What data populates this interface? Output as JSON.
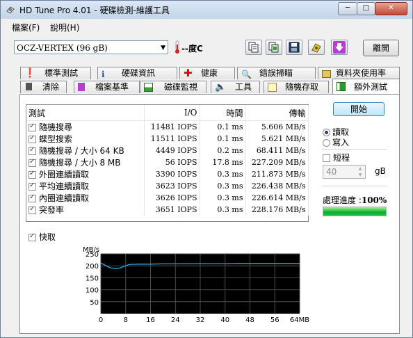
{
  "window": {
    "title": "HD Tune Pro 4.01 - 硬碟檢測-維護工具"
  },
  "menu": [
    {
      "label": "檔案(F)"
    },
    {
      "label": "說明(H)"
    }
  ],
  "toolbar": {
    "drive": "OCZ-VERTEX (96 gB)",
    "temperature": "--度C",
    "exit_label": "離開",
    "buttons": [
      "copy-text-icon",
      "copy-screenshot-icon",
      "save-icon",
      "options-icon",
      "download-icon"
    ]
  },
  "tabs_top": [
    {
      "label": "標準測試",
      "icon": "benchmark-icon"
    },
    {
      "label": "硬碟資訊",
      "icon": "info-icon"
    },
    {
      "label": "健康",
      "icon": "health-icon"
    },
    {
      "label": "錯誤掃瞄",
      "icon": "error-scan-icon"
    },
    {
      "label": "資料夾使用率",
      "icon": "folder-usage-icon"
    }
  ],
  "tabs_bottom": [
    {
      "label": "清除",
      "icon": "erase-icon"
    },
    {
      "label": "檔案基準",
      "icon": "file-benchmark-icon"
    },
    {
      "label": "磁碟監視",
      "icon": "disk-monitor-icon"
    },
    {
      "label": "工具",
      "icon": "tools-icon"
    },
    {
      "label": "隨機存取",
      "icon": "random-access-icon"
    },
    {
      "label": "額外測試",
      "icon": "extra-tests-icon",
      "active": true
    }
  ],
  "results": {
    "columns": [
      "測試",
      "I/O",
      "時間",
      "傳輸"
    ],
    "rows": [
      {
        "name": "隨機搜尋",
        "io": "11481 IOPS",
        "time": "0.1 ms",
        "transfer": "5.606 MB/s"
      },
      {
        "name": "蝶型搜索",
        "io": "11511 IOPS",
        "time": "0.1 ms",
        "transfer": "5.621 MB/s"
      },
      {
        "name": "隨機搜尋 / 大小 64 KB",
        "io": "4449 IOPS",
        "time": "0.2 ms",
        "transfer": "68.411 MB/s"
      },
      {
        "name": "隨機搜尋 / 大小 8 MB",
        "io": "56 IOPS",
        "time": "17.8 ms",
        "transfer": "227.209 MB/s"
      },
      {
        "name": "外圈連續讀取",
        "io": "3390 IOPS",
        "time": "0.3 ms",
        "transfer": "211.873 MB/s"
      },
      {
        "name": "平均連續讀取",
        "io": "3623 IOPS",
        "time": "0.3 ms",
        "transfer": "226.438 MB/s"
      },
      {
        "name": "內圈連續讀取",
        "io": "3626 IOPS",
        "time": "0.3 ms",
        "transfer": "226.614 MB/s"
      },
      {
        "name": "突發率",
        "io": "3651 IOPS",
        "time": "0.3 ms",
        "transfer": "228.176 MB/s"
      }
    ]
  },
  "controls": {
    "start_label": "開始",
    "read_label": "讀取",
    "write_label": "寫入",
    "short_label": "短程",
    "size_value": "40",
    "size_unit": "gB",
    "progress_label": "處理進度 :",
    "progress_value": "100%",
    "progress_fraction": 1.0,
    "cache_label": "快取"
  },
  "colors": {
    "graph_bg": "#000000",
    "graph_grid": "#4a4a4a",
    "graph_line": "#3aa0d8",
    "progress": "#06b025"
  },
  "chart_data": {
    "type": "line",
    "ylabel": "MB/s",
    "xlabel": "",
    "x_unit": "MB",
    "x_ticks": [
      "0",
      "8",
      "16",
      "24",
      "32",
      "40",
      "48",
      "56",
      "64MB"
    ],
    "y_ticks": [
      "250",
      "200",
      "150",
      "100",
      "50"
    ],
    "xlim": [
      0,
      64
    ],
    "ylim": [
      0,
      250
    ],
    "grid": true,
    "series": [
      {
        "x": [
          0,
          1,
          2,
          3,
          4,
          5,
          6,
          7,
          8,
          9,
          10,
          12,
          16,
          20,
          24,
          28,
          32,
          36,
          40,
          44,
          48,
          52,
          56,
          60,
          64
        ],
        "values": [
          212,
          205,
          198,
          192,
          190,
          188,
          190,
          195,
          200,
          205,
          206,
          207,
          207,
          208,
          208,
          209,
          209,
          209,
          209,
          210,
          210,
          210,
          210,
          210,
          210
        ]
      }
    ]
  }
}
